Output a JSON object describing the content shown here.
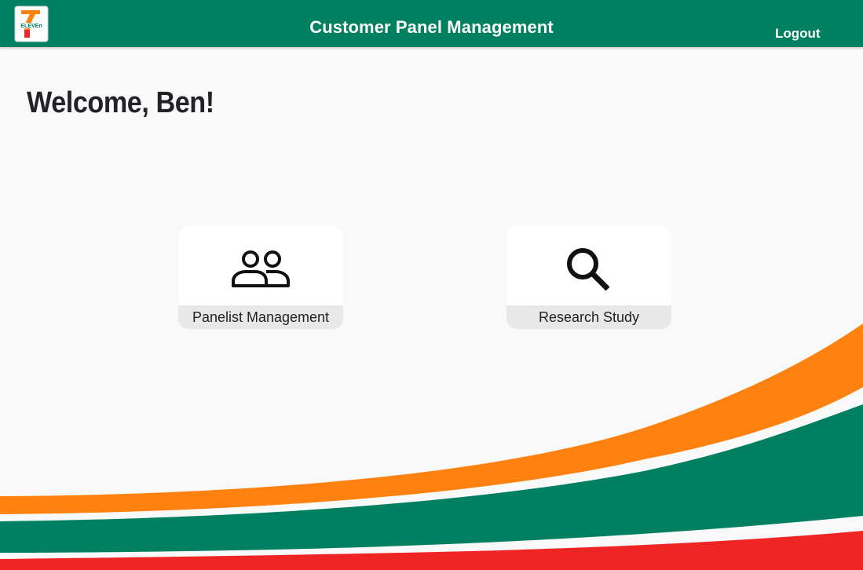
{
  "header": {
    "logo_icon": "7-eleven-logo",
    "logo_text": "ELEVEn",
    "title": "Customer Panel Management",
    "logout_label": "Logout"
  },
  "main": {
    "welcome": "Welcome, Ben!",
    "tiles": [
      {
        "label": "Panelist Management",
        "icon": "people-icon"
      },
      {
        "label": "Research Study",
        "icon": "search-icon"
      }
    ]
  },
  "colors": {
    "brand_green": "#008060",
    "brand_orange": "#ff8210",
    "brand_red": "#ee2524",
    "background": "#f9f9f9",
    "tile_label_bg": "#e8e8e8"
  }
}
